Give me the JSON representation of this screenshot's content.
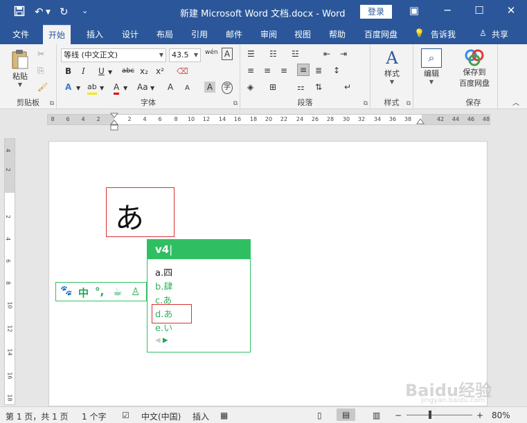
{
  "window": {
    "title": "新建 Microsoft Word 文档.docx  -  Word",
    "login_label": "登录",
    "qa_save_icon": "save-icon",
    "qa_undo": "↶",
    "qa_redo": "↻",
    "qa_more": "⌄",
    "ribbon_opts": "▣",
    "minimize": "─",
    "maximize": "☐",
    "close": "✕"
  },
  "tabs": [
    "文件",
    "开始",
    "插入",
    "设计",
    "布局",
    "引用",
    "邮件",
    "审阅",
    "视图",
    "帮助",
    "百度网盘"
  ],
  "tell_me": "告诉我",
  "share": "共享",
  "ribbon": {
    "clipboard": {
      "paste_label": "粘贴",
      "group_label": "剪贴板"
    },
    "font": {
      "font_name": "等线 (中文正文)",
      "font_size": "43.5",
      "bold": "B",
      "italic": "I",
      "underline": "U",
      "strike": "abc",
      "subscript": "x₂",
      "superscript": "x²",
      "text_effect": "A",
      "highlight": "ab",
      "font_color": "A",
      "case": "Aa",
      "grow": "A",
      "shrink": "A",
      "char_shade": "A",
      "enclose": "字",
      "pinyin": "wén",
      "border_char": "A",
      "group_label": "字体"
    },
    "paragraph": {
      "group_label": "段落"
    },
    "styles": {
      "label": "样式",
      "group_label": "样式"
    },
    "editing": {
      "label": "编辑"
    },
    "save": {
      "label_line1": "保存到",
      "label_line2": "百度网盘",
      "group_label": "保存"
    }
  },
  "ruler": {
    "corner": "L",
    "h_ticks": [
      "8",
      "6",
      "4",
      "2",
      "2",
      "4",
      "6",
      "8",
      "10",
      "12",
      "14",
      "16",
      "18",
      "20",
      "22",
      "24",
      "26",
      "28",
      "30",
      "32",
      "34",
      "36",
      "38",
      "42",
      "44",
      "46",
      "48"
    ],
    "v_ticks": [
      "4",
      "2",
      "2",
      "4",
      "6",
      "8",
      "10",
      "12",
      "14",
      "16",
      "18"
    ]
  },
  "document": {
    "character": "あ"
  },
  "ime": {
    "toolbar": {
      "paw": "🐾",
      "mode": "中",
      "punct": "°,",
      "cup": "☕",
      "user": "♙"
    },
    "input": "v4",
    "candidates": [
      {
        "key": "a.",
        "text": "四"
      },
      {
        "key": "b.",
        "text": "肆"
      },
      {
        "key": "c.",
        "text": "あ"
      },
      {
        "key": "d.",
        "text": "あ"
      },
      {
        "key": "e.",
        "text": "い"
      }
    ],
    "prev": "◀",
    "next": "▶"
  },
  "status": {
    "page": "第 1 页，共 1 页",
    "words": "1 个字",
    "language": "中文(中国)",
    "mode": "插入",
    "zoom": "80%",
    "zoom_minus": "−",
    "zoom_plus": "+"
  },
  "watermark": {
    "brand": "Baidu经验",
    "url": "jingyan.baidu.com"
  },
  "colors": {
    "word_blue": "#2b579a",
    "ime_green": "#2fbf62",
    "selection_red": "#d9302f"
  }
}
